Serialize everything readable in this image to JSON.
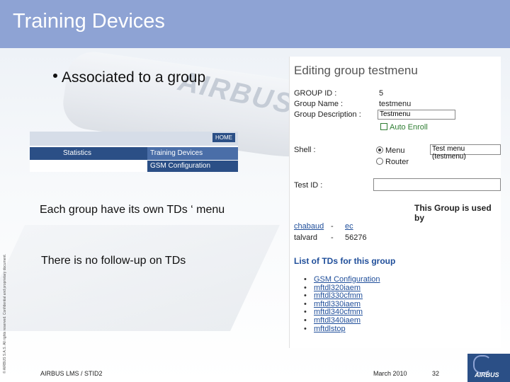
{
  "header": {
    "title": "Training Devices"
  },
  "background": {
    "plane_text": "AIRBUS A3"
  },
  "bullet": {
    "text": "Associated to a group"
  },
  "menu": {
    "home": "HOME",
    "statistics": "Statistics",
    "training_devices": "Training Devices",
    "gsm_configuration": "GSM Configuration"
  },
  "descriptions": {
    "own_menu": "Each group have its own TDs ‘ menu",
    "no_followup": "There is no follow-up on TDs"
  },
  "copyright": "© AIRBUS S.A.S. All rights reserved. Confidential and proprietary document.",
  "panel": {
    "title": "Editing group testmenu",
    "group_id_label": "GROUP ID :",
    "group_id_value": "5",
    "group_name_label": "Group Name :",
    "group_name_value": "testmenu",
    "group_desc_label": "Group Description :",
    "group_desc_value": "Testmenu",
    "auto_enroll": "Auto Enroll",
    "shell_label": "Shell :",
    "shell_option_menu": "Menu",
    "shell_option_router": "Router",
    "shell_select_value": "Test menu (testmenu)",
    "test_id_label": "Test ID :",
    "used_by_title": "This Group is used by",
    "users": [
      {
        "name": "chabaud",
        "sep": "-",
        "value": "ec"
      },
      {
        "name": "talvard",
        "sep": "-",
        "value": "56276"
      }
    ],
    "tds_title": "List of TDs for this group",
    "tds": [
      "GSM Configuration",
      "mftdl320iaem",
      "mftdl330cfmm",
      "mftdl330iaem",
      "mftdl340cfmm",
      "mftdl340iaem",
      "mftdlstop"
    ]
  },
  "footer": {
    "left": "AIRBUS LMS / STID2",
    "date": "March 2010",
    "page": "32",
    "logo": "AIRBUS"
  }
}
